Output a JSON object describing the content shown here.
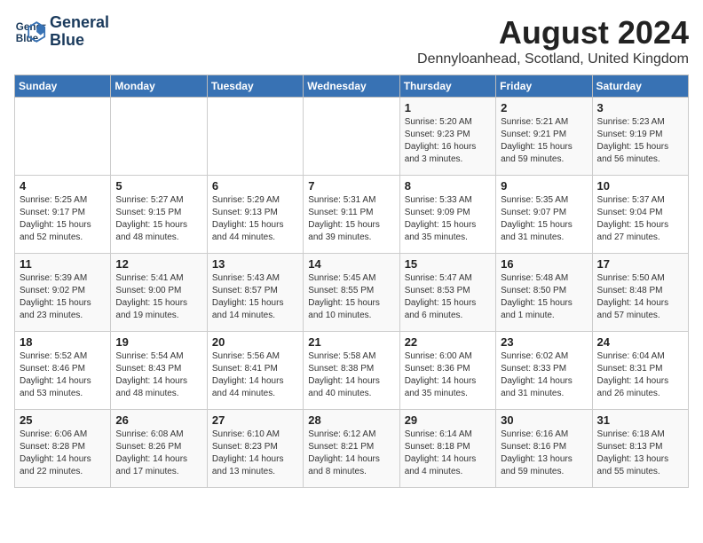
{
  "logo": {
    "line1": "General",
    "line2": "Blue"
  },
  "title": {
    "month_year": "August 2024",
    "location": "Dennyloanhead, Scotland, United Kingdom"
  },
  "headers": [
    "Sunday",
    "Monday",
    "Tuesday",
    "Wednesday",
    "Thursday",
    "Friday",
    "Saturday"
  ],
  "weeks": [
    [
      {
        "day": "",
        "detail": ""
      },
      {
        "day": "",
        "detail": ""
      },
      {
        "day": "",
        "detail": ""
      },
      {
        "day": "",
        "detail": ""
      },
      {
        "day": "1",
        "detail": "Sunrise: 5:20 AM\nSunset: 9:23 PM\nDaylight: 16 hours\nand 3 minutes."
      },
      {
        "day": "2",
        "detail": "Sunrise: 5:21 AM\nSunset: 9:21 PM\nDaylight: 15 hours\nand 59 minutes."
      },
      {
        "day": "3",
        "detail": "Sunrise: 5:23 AM\nSunset: 9:19 PM\nDaylight: 15 hours\nand 56 minutes."
      }
    ],
    [
      {
        "day": "4",
        "detail": "Sunrise: 5:25 AM\nSunset: 9:17 PM\nDaylight: 15 hours\nand 52 minutes."
      },
      {
        "day": "5",
        "detail": "Sunrise: 5:27 AM\nSunset: 9:15 PM\nDaylight: 15 hours\nand 48 minutes."
      },
      {
        "day": "6",
        "detail": "Sunrise: 5:29 AM\nSunset: 9:13 PM\nDaylight: 15 hours\nand 44 minutes."
      },
      {
        "day": "7",
        "detail": "Sunrise: 5:31 AM\nSunset: 9:11 PM\nDaylight: 15 hours\nand 39 minutes."
      },
      {
        "day": "8",
        "detail": "Sunrise: 5:33 AM\nSunset: 9:09 PM\nDaylight: 15 hours\nand 35 minutes."
      },
      {
        "day": "9",
        "detail": "Sunrise: 5:35 AM\nSunset: 9:07 PM\nDaylight: 15 hours\nand 31 minutes."
      },
      {
        "day": "10",
        "detail": "Sunrise: 5:37 AM\nSunset: 9:04 PM\nDaylight: 15 hours\nand 27 minutes."
      }
    ],
    [
      {
        "day": "11",
        "detail": "Sunrise: 5:39 AM\nSunset: 9:02 PM\nDaylight: 15 hours\nand 23 minutes."
      },
      {
        "day": "12",
        "detail": "Sunrise: 5:41 AM\nSunset: 9:00 PM\nDaylight: 15 hours\nand 19 minutes."
      },
      {
        "day": "13",
        "detail": "Sunrise: 5:43 AM\nSunset: 8:57 PM\nDaylight: 15 hours\nand 14 minutes."
      },
      {
        "day": "14",
        "detail": "Sunrise: 5:45 AM\nSunset: 8:55 PM\nDaylight: 15 hours\nand 10 minutes."
      },
      {
        "day": "15",
        "detail": "Sunrise: 5:47 AM\nSunset: 8:53 PM\nDaylight: 15 hours\nand 6 minutes."
      },
      {
        "day": "16",
        "detail": "Sunrise: 5:48 AM\nSunset: 8:50 PM\nDaylight: 15 hours\nand 1 minute."
      },
      {
        "day": "17",
        "detail": "Sunrise: 5:50 AM\nSunset: 8:48 PM\nDaylight: 14 hours\nand 57 minutes."
      }
    ],
    [
      {
        "day": "18",
        "detail": "Sunrise: 5:52 AM\nSunset: 8:46 PM\nDaylight: 14 hours\nand 53 minutes."
      },
      {
        "day": "19",
        "detail": "Sunrise: 5:54 AM\nSunset: 8:43 PM\nDaylight: 14 hours\nand 48 minutes."
      },
      {
        "day": "20",
        "detail": "Sunrise: 5:56 AM\nSunset: 8:41 PM\nDaylight: 14 hours\nand 44 minutes."
      },
      {
        "day": "21",
        "detail": "Sunrise: 5:58 AM\nSunset: 8:38 PM\nDaylight: 14 hours\nand 40 minutes."
      },
      {
        "day": "22",
        "detail": "Sunrise: 6:00 AM\nSunset: 8:36 PM\nDaylight: 14 hours\nand 35 minutes."
      },
      {
        "day": "23",
        "detail": "Sunrise: 6:02 AM\nSunset: 8:33 PM\nDaylight: 14 hours\nand 31 minutes."
      },
      {
        "day": "24",
        "detail": "Sunrise: 6:04 AM\nSunset: 8:31 PM\nDaylight: 14 hours\nand 26 minutes."
      }
    ],
    [
      {
        "day": "25",
        "detail": "Sunrise: 6:06 AM\nSunset: 8:28 PM\nDaylight: 14 hours\nand 22 minutes."
      },
      {
        "day": "26",
        "detail": "Sunrise: 6:08 AM\nSunset: 8:26 PM\nDaylight: 14 hours\nand 17 minutes."
      },
      {
        "day": "27",
        "detail": "Sunrise: 6:10 AM\nSunset: 8:23 PM\nDaylight: 14 hours\nand 13 minutes."
      },
      {
        "day": "28",
        "detail": "Sunrise: 6:12 AM\nSunset: 8:21 PM\nDaylight: 14 hours\nand 8 minutes."
      },
      {
        "day": "29",
        "detail": "Sunrise: 6:14 AM\nSunset: 8:18 PM\nDaylight: 14 hours\nand 4 minutes."
      },
      {
        "day": "30",
        "detail": "Sunrise: 6:16 AM\nSunset: 8:16 PM\nDaylight: 13 hours\nand 59 minutes."
      },
      {
        "day": "31",
        "detail": "Sunrise: 6:18 AM\nSunset: 8:13 PM\nDaylight: 13 hours\nand 55 minutes."
      }
    ]
  ]
}
